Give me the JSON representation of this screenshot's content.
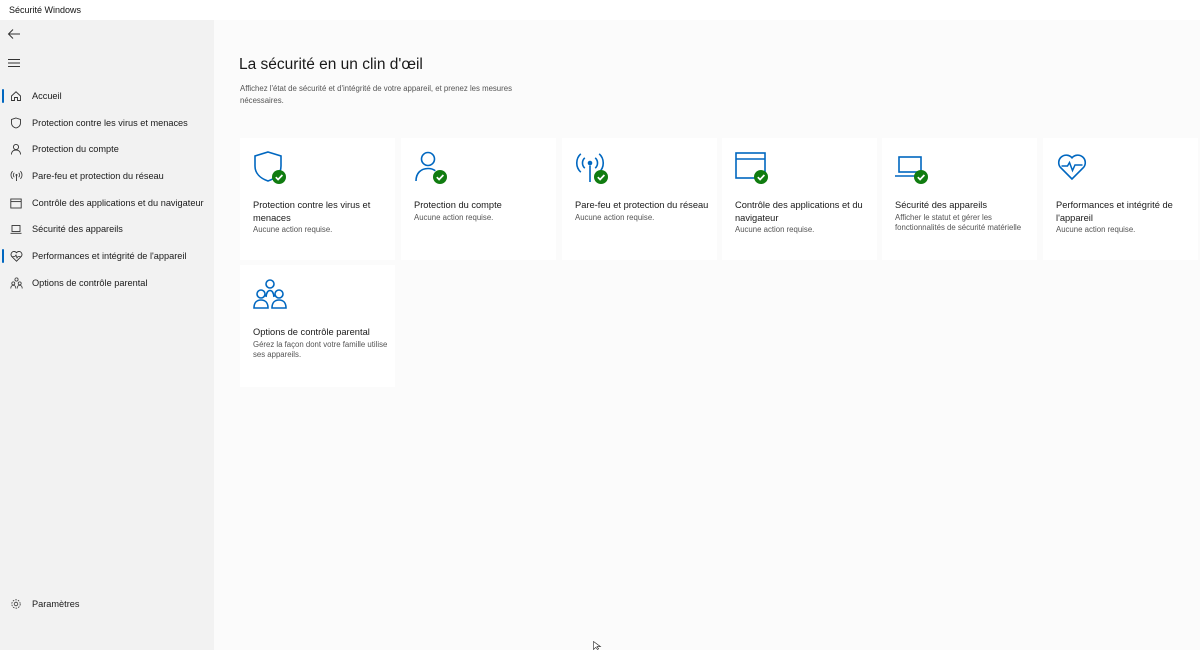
{
  "window": {
    "title": "Sécurité Windows"
  },
  "sidebar": {
    "items": [
      {
        "label": "Accueil",
        "icon": "home-icon"
      },
      {
        "label": "Protection contre les virus et menaces",
        "icon": "shield-icon"
      },
      {
        "label": "Protection du compte",
        "icon": "person-icon"
      },
      {
        "label": "Pare-feu et protection du réseau",
        "icon": "wifi-antenna-icon"
      },
      {
        "label": "Contrôle des applications et du navigateur",
        "icon": "browser-window-icon"
      },
      {
        "label": "Sécurité des appareils",
        "icon": "laptop-icon"
      },
      {
        "label": "Performances et intégrité de l'appareil",
        "icon": "heart-pulse-icon"
      },
      {
        "label": "Options de contrôle parental",
        "icon": "family-icon"
      }
    ],
    "settings_label": "Paramètres"
  },
  "main": {
    "title": "La sécurité en un clin d'œil",
    "subtitle": "Affichez l'état de sécurité et d'intégrité de votre appareil, et prenez les mesures nécessaires.",
    "tiles": [
      {
        "title": "Protection contre les virus et menaces",
        "status": "Aucune action requise.",
        "icon": "shield-check-icon"
      },
      {
        "title": "Protection du compte",
        "status": "Aucune action requise.",
        "icon": "person-check-icon"
      },
      {
        "title": "Pare-feu et protection du réseau",
        "status": "Aucune action requise.",
        "icon": "antenna-check-icon"
      },
      {
        "title": "Contrôle des applications et du navigateur",
        "status": "Aucune action requise.",
        "icon": "browser-check-icon"
      },
      {
        "title": "Sécurité des appareils",
        "status": "Afficher le statut et gérer les fonctionnalités de sécurité matérielle",
        "icon": "laptop-check-icon"
      },
      {
        "title": "Performances et intégrité de l'appareil",
        "status": "Aucune action requise.",
        "icon": "heart-pulse-icon"
      },
      {
        "title": "Options de contrôle parental",
        "status": "Gérez la façon dont votre famille utilise ses appareils.",
        "icon": "family-icon"
      }
    ]
  },
  "colors": {
    "accent": "#0067c0",
    "ok": "#107c10",
    "sidebar_bg": "#f2f2f2"
  }
}
